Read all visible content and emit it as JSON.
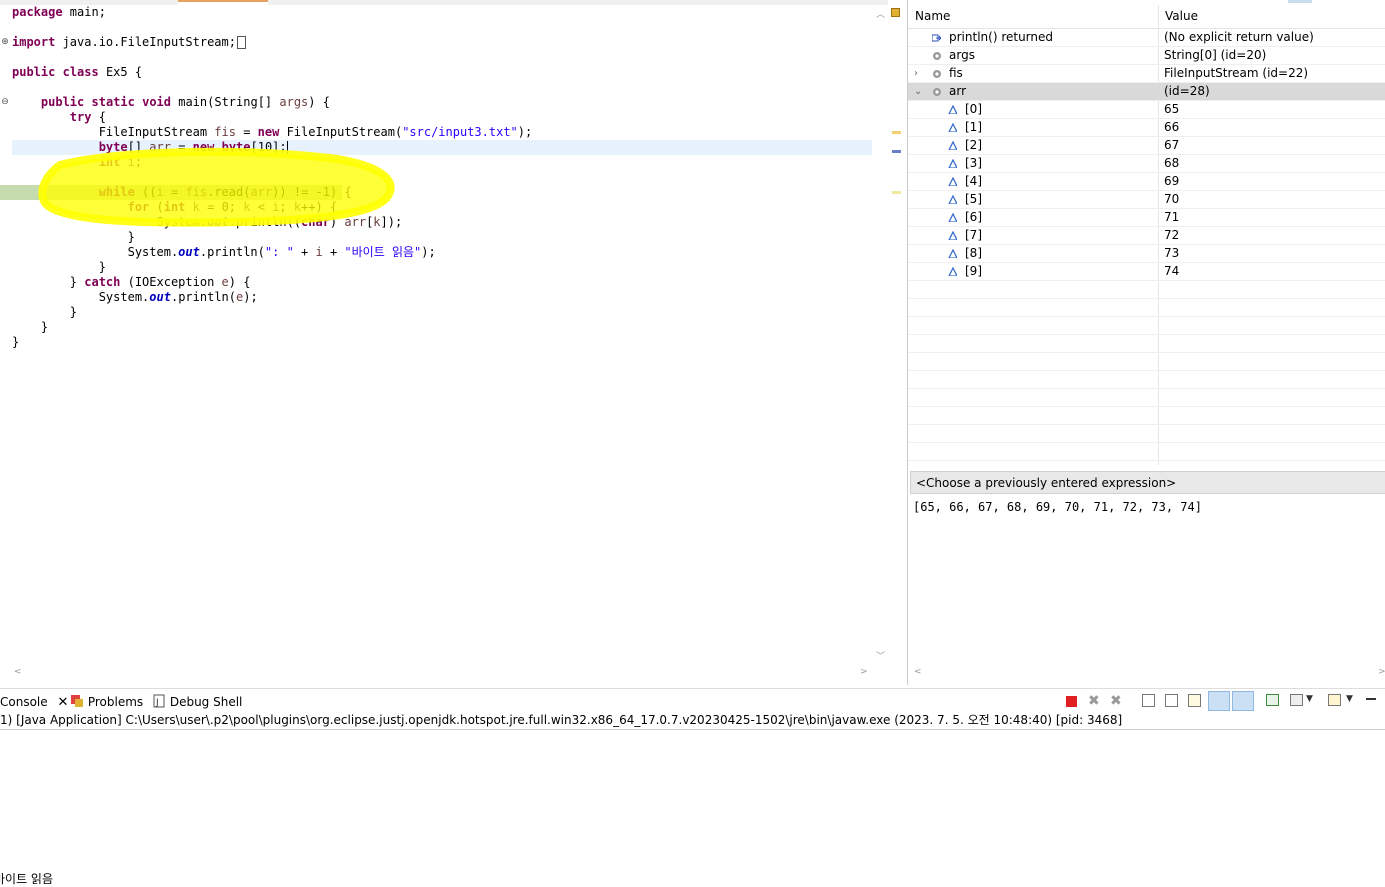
{
  "editor": {
    "lines": [
      {
        "segs": [
          {
            "t": "package",
            "c": "kw"
          },
          {
            "t": " main;"
          }
        ]
      },
      {
        "segs": []
      },
      {
        "segs": [
          {
            "t": "import",
            "c": "kw"
          },
          {
            "t": " java.io.FileInputStream;"
          }
        ],
        "box": true
      },
      {
        "segs": []
      },
      {
        "segs": [
          {
            "t": "public",
            "c": "kw"
          },
          {
            "t": " "
          },
          {
            "t": "class",
            "c": "kw"
          },
          {
            "t": " Ex5 {"
          }
        ]
      },
      {
        "segs": []
      },
      {
        "segs": [
          {
            "t": "    "
          },
          {
            "t": "public",
            "c": "kw"
          },
          {
            "t": " "
          },
          {
            "t": "static",
            "c": "kw"
          },
          {
            "t": " "
          },
          {
            "t": "void",
            "c": "kw"
          },
          {
            "t": " main(String[] "
          },
          {
            "t": "args",
            "c": "var"
          },
          {
            "t": ") {"
          }
        ]
      },
      {
        "segs": [
          {
            "t": "        "
          },
          {
            "t": "try",
            "c": "kw"
          },
          {
            "t": " {"
          }
        ]
      },
      {
        "segs": [
          {
            "t": "            FileInputStream "
          },
          {
            "t": "fis",
            "c": "var"
          },
          {
            "t": " = "
          },
          {
            "t": "new",
            "c": "kw"
          },
          {
            "t": " FileInputStream("
          },
          {
            "t": "\"src/input3.txt\"",
            "c": "str"
          },
          {
            "t": ");"
          }
        ]
      },
      {
        "segs": [
          {
            "t": "            "
          },
          {
            "t": "byte",
            "c": "kw"
          },
          {
            "t": "[] "
          },
          {
            "t": "arr",
            "c": "var"
          },
          {
            "t": " = "
          },
          {
            "t": "new",
            "c": "kw"
          },
          {
            "t": " "
          },
          {
            "t": "byte",
            "c": "kw"
          },
          {
            "t": "[10];"
          }
        ],
        "cursor": true
      },
      {
        "segs": [
          {
            "t": "            "
          },
          {
            "t": "int",
            "c": "kw"
          },
          {
            "t": " "
          },
          {
            "t": "i",
            "c": "var"
          },
          {
            "t": ";"
          }
        ]
      },
      {
        "segs": []
      },
      {
        "segs": [
          {
            "t": "            "
          },
          {
            "t": "while",
            "c": "kw"
          },
          {
            "t": " (("
          },
          {
            "t": "i",
            "c": "var"
          },
          {
            "t": " = "
          },
          {
            "t": "fis",
            "c": "var"
          },
          {
            "t": ".read("
          },
          {
            "t": "arr",
            "c": "var"
          },
          {
            "t": ")) != -1) {"
          }
        ],
        "debug": true
      },
      {
        "segs": [
          {
            "t": "                "
          },
          {
            "t": "for",
            "c": "kw"
          },
          {
            "t": " ("
          },
          {
            "t": "int",
            "c": "kw"
          },
          {
            "t": " "
          },
          {
            "t": "k",
            "c": "var"
          },
          {
            "t": " = 0; "
          },
          {
            "t": "k",
            "c": "var"
          },
          {
            "t": " < "
          },
          {
            "t": "i",
            "c": "var"
          },
          {
            "t": "; "
          },
          {
            "t": "k",
            "c": "var"
          },
          {
            "t": "++) {"
          }
        ]
      },
      {
        "segs": [
          {
            "t": "                    System."
          },
          {
            "t": "out",
            "c": "st"
          },
          {
            "t": ".println(("
          },
          {
            "t": "char",
            "c": "kw"
          },
          {
            "t": ") "
          },
          {
            "t": "arr",
            "c": "var"
          },
          {
            "t": "["
          },
          {
            "t": "k",
            "c": "var"
          },
          {
            "t": "]);"
          }
        ]
      },
      {
        "segs": [
          {
            "t": "                }"
          }
        ]
      },
      {
        "segs": [
          {
            "t": "                System."
          },
          {
            "t": "out",
            "c": "st"
          },
          {
            "t": ".println("
          },
          {
            "t": "\": \"",
            "c": "str"
          },
          {
            "t": " + "
          },
          {
            "t": "i",
            "c": "var"
          },
          {
            "t": " + "
          },
          {
            "t": "\"바이트 읽음\"",
            "c": "str"
          },
          {
            "t": ");"
          }
        ]
      },
      {
        "segs": [
          {
            "t": "            }"
          }
        ]
      },
      {
        "segs": [
          {
            "t": "        } "
          },
          {
            "t": "catch",
            "c": "kw"
          },
          {
            "t": " (IOException "
          },
          {
            "t": "e",
            "c": "var"
          },
          {
            "t": ") {"
          }
        ]
      },
      {
        "segs": [
          {
            "t": "            System."
          },
          {
            "t": "out",
            "c": "st"
          },
          {
            "t": ".println("
          },
          {
            "t": "e",
            "c": "var"
          },
          {
            "t": ");"
          }
        ]
      },
      {
        "segs": [
          {
            "t": "        }"
          }
        ]
      },
      {
        "segs": [
          {
            "t": "    }"
          }
        ]
      },
      {
        "segs": [
          {
            "t": "}"
          }
        ]
      }
    ]
  },
  "variables": {
    "header": {
      "name": "Name",
      "value": "Value"
    },
    "rows": [
      {
        "name": "println() returned",
        "value": "(No explicit return value)",
        "icon": "return-icon",
        "level": 0,
        "expand": ""
      },
      {
        "name": "args",
        "value": "String[0]  (id=20)",
        "icon": "local-var-icon",
        "level": 0,
        "expand": ""
      },
      {
        "name": "fis",
        "value": "FileInputStream  (id=22)",
        "icon": "local-var-icon",
        "level": 0,
        "expand": ">"
      },
      {
        "name": "arr",
        "value": "(id=28)",
        "icon": "local-var-icon",
        "level": 0,
        "expand": "v",
        "selected": true
      },
      {
        "name": "[0]",
        "value": "65",
        "icon": "array-element-icon",
        "level": 1
      },
      {
        "name": "[1]",
        "value": "66",
        "icon": "array-element-icon",
        "level": 1
      },
      {
        "name": "[2]",
        "value": "67",
        "icon": "array-element-icon",
        "level": 1
      },
      {
        "name": "[3]",
        "value": "68",
        "icon": "array-element-icon",
        "level": 1
      },
      {
        "name": "[4]",
        "value": "69",
        "icon": "array-element-icon",
        "level": 1
      },
      {
        "name": "[5]",
        "value": "70",
        "icon": "array-element-icon",
        "level": 1
      },
      {
        "name": "[6]",
        "value": "71",
        "icon": "array-element-icon",
        "level": 1
      },
      {
        "name": "[7]",
        "value": "72",
        "icon": "array-element-icon",
        "level": 1
      },
      {
        "name": "[8]",
        "value": "73",
        "icon": "array-element-icon",
        "level": 1
      },
      {
        "name": "[9]",
        "value": "74",
        "icon": "array-element-icon",
        "level": 1
      }
    ],
    "empty_rows": 10,
    "expression_placeholder": "<Choose a previously entered expression>",
    "expression_result": "[65, 66, 67, 68, 69, 70, 71, 72, 73, 74]"
  },
  "console": {
    "tabs": [
      {
        "label": "Console",
        "name": "tab-console"
      },
      {
        "label": "Problems",
        "name": "tab-problems"
      },
      {
        "label": "Debug Shell",
        "name": "tab-debug-shell"
      }
    ],
    "info": "1) [Java Application] C:\\Users\\user\\.p2\\pool\\plugins\\org.eclipse.justj.openjdk.hotspot.jre.full.win32.x86_64_17.0.7.v20230425-1502\\jre\\bin\\javaw.exe  (2023. 7. 5. 오전 10:48:40) [pid: 3468]",
    "output": "바이트 읽음"
  },
  "colors": {
    "highlighter": "#ffff00",
    "debug_line": "#c6dbae",
    "current_line": "#e8f2fe",
    "keyword": "#7f0055",
    "string": "#2a00ff"
  }
}
